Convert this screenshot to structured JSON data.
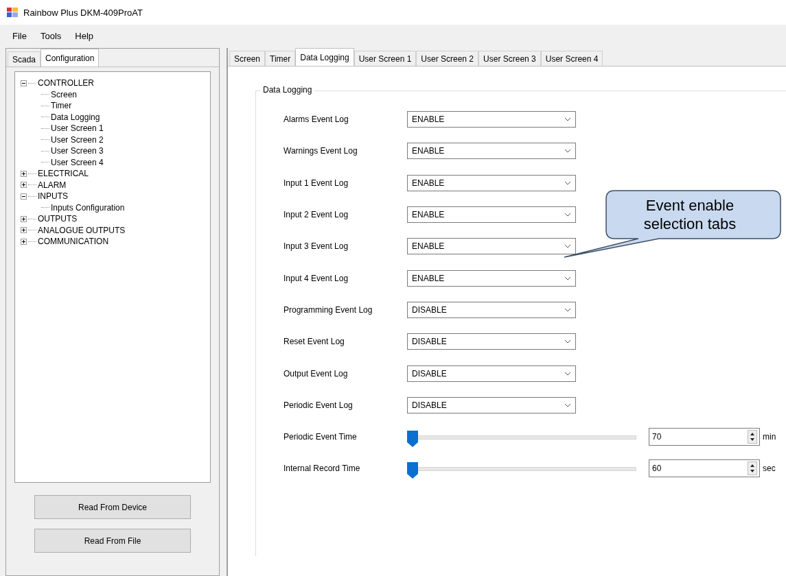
{
  "window": {
    "title": "Rainbow Plus DKM-409ProAT"
  },
  "menu": [
    "File",
    "Tools",
    "Help"
  ],
  "left_tabs": [
    {
      "label": "Scada",
      "selected": false
    },
    {
      "label": "Configuration",
      "selected": true
    }
  ],
  "tree": [
    {
      "label": "CONTROLLER",
      "expanded": true,
      "children": [
        {
          "label": "Screen"
        },
        {
          "label": "Timer"
        },
        {
          "label": "Data Logging"
        },
        {
          "label": "User Screen 1"
        },
        {
          "label": "User Screen 2"
        },
        {
          "label": "User Screen 3"
        },
        {
          "label": "User Screen 4"
        }
      ]
    },
    {
      "label": "ELECTRICAL",
      "expanded": false
    },
    {
      "label": "ALARM",
      "expanded": false
    },
    {
      "label": "INPUTS",
      "expanded": true,
      "children": [
        {
          "label": "Inputs Configuration"
        }
      ]
    },
    {
      "label": "OUTPUTS",
      "expanded": false
    },
    {
      "label": "ANALOGUE OUTPUTS",
      "expanded": false
    },
    {
      "label": "COMMUNICATION",
      "expanded": false
    }
  ],
  "left_buttons": [
    "Read From Device",
    "Read From File"
  ],
  "tabs": [
    {
      "label": "Screen",
      "selected": false
    },
    {
      "label": "Timer",
      "selected": false
    },
    {
      "label": "Data Logging",
      "selected": true
    },
    {
      "label": "User Screen 1",
      "selected": false
    },
    {
      "label": "User Screen 2",
      "selected": false
    },
    {
      "label": "User Screen 3",
      "selected": false
    },
    {
      "label": "User Screen 4",
      "selected": false
    }
  ],
  "group": {
    "title": "Data Logging",
    "rows": [
      {
        "kind": "combo",
        "label": "Alarms Event Log",
        "value": "ENABLE"
      },
      {
        "kind": "combo",
        "label": "Warnings Event Log",
        "value": "ENABLE"
      },
      {
        "kind": "combo",
        "label": "Input 1 Event Log",
        "value": "ENABLE"
      },
      {
        "kind": "combo",
        "label": "Input 2 Event Log",
        "value": "ENABLE"
      },
      {
        "kind": "combo",
        "label": "Input 3 Event Log",
        "value": "ENABLE"
      },
      {
        "kind": "combo",
        "label": "Input 4 Event Log",
        "value": "ENABLE"
      },
      {
        "kind": "combo",
        "label": "Programming Event Log",
        "value": "DISABLE"
      },
      {
        "kind": "combo",
        "label": "Reset Event Log",
        "value": "DISABLE"
      },
      {
        "kind": "combo",
        "label": "Output Event Log",
        "value": "DISABLE"
      },
      {
        "kind": "combo",
        "label": "Periodic Event Log",
        "value": "DISABLE"
      },
      {
        "kind": "slider",
        "label": "Periodic Event Time",
        "level": 0,
        "value": "70",
        "unit": "min"
      },
      {
        "kind": "slider",
        "label": "Internal Record Time",
        "level": 0,
        "value": "60",
        "unit": "sec"
      }
    ]
  },
  "callout": {
    "text": "Event enable selection tabs"
  }
}
